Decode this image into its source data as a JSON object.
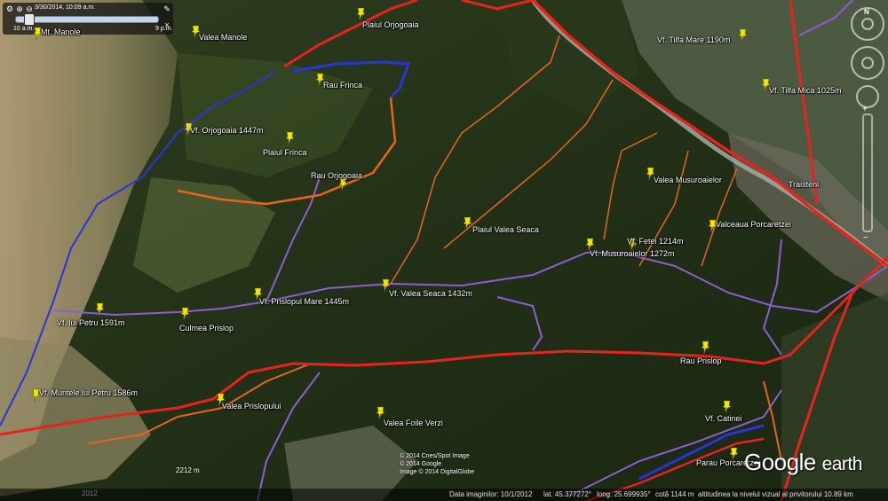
{
  "timeslider": {
    "date": "3/30/2014, 10:09 a.m.",
    "start": "10 a.m.",
    "end": "9 p.m.",
    "progress": 0.06
  },
  "places": [
    {
      "name": "Mt. Manole",
      "id": "mt-manole"
    },
    {
      "name": "Valea Manole",
      "id": "valea-manole"
    },
    {
      "name": "Plaiul Orjogoaia",
      "id": "plaiul-orjogoaia"
    },
    {
      "name": "Rau Frinca",
      "id": "rau-frinca"
    },
    {
      "name": "Vf. Orjogoaia 1447m",
      "id": "vf-orjogoaia"
    },
    {
      "name": "Plaiul Frinca",
      "id": "plaiul-frinca"
    },
    {
      "name": "Rau Orjogoaia",
      "id": "rau-orjogoaia"
    },
    {
      "name": "Plaiul Valea Seaca",
      "id": "plaiul-valea-seaca"
    },
    {
      "name": "Vf. Tilfa Mare 1190m",
      "id": "vf-tilfa-mare"
    },
    {
      "name": "Vf. Tilfa Mica 1025m",
      "id": "vf-tilfa-mica"
    },
    {
      "name": "Valea Musuroaielor",
      "id": "valea-musuroaielor"
    },
    {
      "name": "Traisteni",
      "id": "traisteni"
    },
    {
      "name": "Valceaua Porcaretzei",
      "id": "valceaua-porcaretzei"
    },
    {
      "name": "Vf. Fetei 1214m",
      "id": "vf-fetei"
    },
    {
      "name": "Vf. Musuroaielor 1272m",
      "id": "vf-musuroaielor"
    },
    {
      "name": "Vf. Valea Seaca 1432m",
      "id": "vf-valea-seaca"
    },
    {
      "name": "Vf. Prislopul Mare 1445m",
      "id": "vf-prislopul-mare"
    },
    {
      "name": "Vf. lui Petru 1591m",
      "id": "vf-lui-petru"
    },
    {
      "name": "Culmea Prislop",
      "id": "culmea-prislop"
    },
    {
      "name": "Rau Prislop",
      "id": "rau-prislop"
    },
    {
      "name": "Vf. Muntele lui Petru 1586m",
      "id": "vf-muntele-lui-petru"
    },
    {
      "name": "Valea Prislopului",
      "id": "valea-prislopului"
    },
    {
      "name": "Valea Foile Verzi",
      "id": "valea-foile-verzi"
    },
    {
      "name": "Vf. Catinei",
      "id": "vf-catinei"
    },
    {
      "name": "Parau Porcaretzei",
      "id": "parau-porcaretzei"
    }
  ],
  "copyright": {
    "line1": "© 2014 Cnes/Spot Image",
    "line2": "© 2014 Google",
    "line3": "Image © 2014 DigitalGlobe"
  },
  "brand": {
    "google": "Google",
    "earth": "earth"
  },
  "scale_label": "2212 m",
  "imagery_year": "2012",
  "status": {
    "imagery_date": "Data imaginilor: 10/1/2012",
    "lat": "lat.  45.377272°",
    "lon": "long.  25.699935°",
    "elev": "cotă  1144 m",
    "eye_alt": "altitudinea la nivelul vizual al privitorului  10.89 km"
  },
  "colors": {
    "road": "#e8231e",
    "trail_blue": "#2a35d8",
    "trail_orange": "#e8641b",
    "trail_purple": "#8c5fd1",
    "pin": "#f2e600"
  }
}
